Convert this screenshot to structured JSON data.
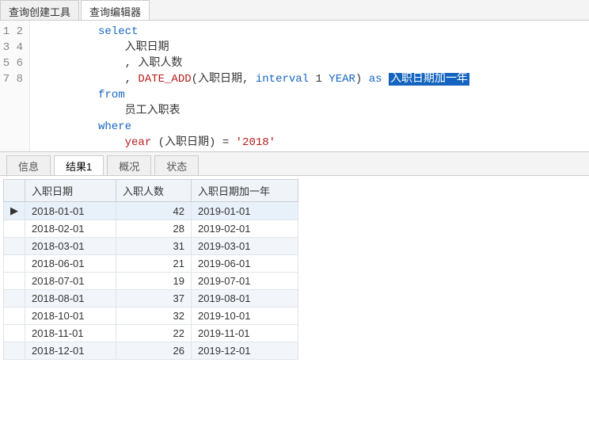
{
  "topTabs": [
    {
      "label": "查询创建工具",
      "active": false
    },
    {
      "label": "查询编辑器",
      "active": true
    }
  ],
  "editor": {
    "lines": [
      "1",
      "2",
      "3",
      "4",
      "5",
      "6",
      "7",
      "8"
    ],
    "sql": {
      "select": "select",
      "field_hiredate": "入职日期",
      "field_count": "入职人数",
      "date_add": "DATE_ADD",
      "date_add_arg": "(入职日期,",
      "interval": "interval",
      "one": "1",
      "year_kw": "YEAR",
      "close_paren": ")",
      "as_kw": "as",
      "alias": "入职日期加一年",
      "from": "from",
      "table": "员工入职表",
      "where": "where",
      "year_func": "year",
      "year_arg": "(入职日期)",
      "eq": "=",
      "year_val": "'2018'"
    }
  },
  "resultTabs": [
    {
      "label": "信息",
      "active": false
    },
    {
      "label": "结果1",
      "active": true
    },
    {
      "label": "概况",
      "active": false
    },
    {
      "label": "状态",
      "active": false
    }
  ],
  "columns": [
    "入职日期",
    "入职人数",
    "入职日期加一年"
  ],
  "rows": [
    {
      "hiredate": "2018-01-01",
      "count": 42,
      "nextyear": "2019-01-01",
      "marker": "▶",
      "sel": true
    },
    {
      "hiredate": "2018-02-01",
      "count": 28,
      "nextyear": "2019-02-01"
    },
    {
      "hiredate": "2018-03-01",
      "count": 31,
      "nextyear": "2019-03-01",
      "alt": true
    },
    {
      "hiredate": "2018-06-01",
      "count": 21,
      "nextyear": "2019-06-01"
    },
    {
      "hiredate": "2018-07-01",
      "count": 19,
      "nextyear": "2019-07-01"
    },
    {
      "hiredate": "2018-08-01",
      "count": 37,
      "nextyear": "2019-08-01",
      "alt": true
    },
    {
      "hiredate": "2018-10-01",
      "count": 32,
      "nextyear": "2019-10-01"
    },
    {
      "hiredate": "2018-11-01",
      "count": 22,
      "nextyear": "2019-11-01"
    },
    {
      "hiredate": "2018-12-01",
      "count": 26,
      "nextyear": "2019-12-01",
      "alt": true
    }
  ]
}
